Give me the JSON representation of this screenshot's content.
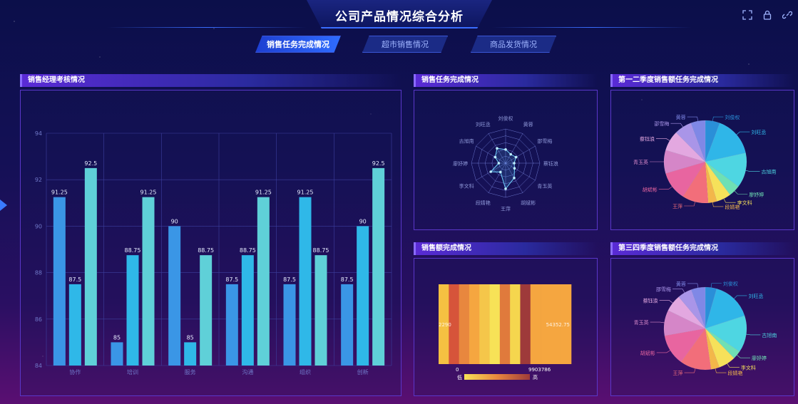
{
  "header": {
    "title": "公司产品情况综合分析"
  },
  "tabs": [
    {
      "label": "销售任务完成情况",
      "active": true
    },
    {
      "label": "超市销售情况",
      "active": false
    },
    {
      "label": "商品发货情况",
      "active": false
    }
  ],
  "icons": [
    "fullscreen-icon",
    "lock-icon",
    "link-icon"
  ],
  "panels": {
    "p1": "销售经理考核情况",
    "p2": "销售任务完成情况",
    "p3": "第一二季度销售额任务完成情况",
    "p4": "销售额完成情况",
    "p5": "第三四季度销售额任务完成情况"
  },
  "chart_data": [
    {
      "type": "bar",
      "title": "",
      "categories": [
        "协作",
        "培训",
        "服务",
        "沟通",
        "组织",
        "创新"
      ],
      "ylim": [
        84,
        94
      ],
      "yticks": [
        84,
        86,
        88,
        90,
        92,
        94
      ],
      "series": [
        {
          "values": [
            91.25,
            85,
            90,
            87.5,
            87.5,
            87.5
          ],
          "color": "#3a96e6"
        },
        {
          "values": [
            87.5,
            88.75,
            85,
            88.75,
            91.25,
            90
          ],
          "color": "#2fb8e8"
        },
        {
          "values": [
            92.5,
            91.25,
            88.75,
            91.25,
            88.75,
            92.5
          ],
          "color": "#5fd0d8"
        }
      ]
    },
    {
      "type": "radar",
      "labels": [
        "刘俊权",
        "黄蓉",
        "邵雪梅",
        "蔡钰浪",
        "青玉英",
        "胡斌彬",
        "王萍",
        "段婧艳",
        "李文科",
        "廖妤婷",
        "古旭南",
        "刘旺丞"
      ],
      "values": [
        0.4,
        0.3,
        0.35,
        0.25,
        0.3,
        0.5,
        0.75,
        0.3,
        0.5,
        0.2,
        0.35,
        0.5
      ]
    },
    {
      "type": "pie",
      "labels": [
        "刘俊权",
        "刘旺丞",
        "古旭南",
        "廖妤婷",
        "李文科",
        "段婧艳",
        "王萍",
        "胡斌彬",
        "青玉英",
        "蔡钰浪",
        "邵雪梅",
        "黄蓉"
      ],
      "values": [
        5,
        14,
        12,
        4,
        5,
        3,
        9,
        10,
        8,
        7,
        6,
        5
      ],
      "colors": [
        "#2a8fd8",
        "#2fb6e8",
        "#4ed6e2",
        "#6fe0b4",
        "#f6e15a",
        "#f3b74a",
        "#f26e7a",
        "#e865a0",
        "#d586c8",
        "#e3a8e0",
        "#a995e8",
        "#7f88e6"
      ]
    },
    {
      "type": "heatmap",
      "label_left": "2290",
      "label_right": "54352.75",
      "min_label": "0",
      "max_label": "9903786",
      "low": "低",
      "high": "高",
      "cells": [
        "#f5c142",
        "#d6543a",
        "#e8873e",
        "#f5a640",
        "#f5c64a",
        "#f7e257",
        "#e07a3c",
        "#f5d64e",
        "#9e3a3a",
        "#f5a640",
        "#f5a640",
        "#f5a640",
        "#f5a640"
      ]
    },
    {
      "type": "pie",
      "labels": [
        "刘俊权",
        "刘旺丞",
        "古旭南",
        "廖妤婷",
        "李文科",
        "段婧艳",
        "王萍",
        "胡斌彬",
        "青玉英",
        "蔡钰浪",
        "邵雪梅",
        "黄蓉"
      ],
      "values": [
        4,
        14,
        13,
        3,
        6,
        3,
        11,
        11,
        9,
        6,
        5,
        5
      ],
      "colors": [
        "#2a8fd8",
        "#2fb6e8",
        "#4ed6e2",
        "#6fe0b4",
        "#f6e15a",
        "#f3b74a",
        "#f26e7a",
        "#e865a0",
        "#d586c8",
        "#e3a8e0",
        "#a995e8",
        "#7f88e6"
      ]
    }
  ]
}
